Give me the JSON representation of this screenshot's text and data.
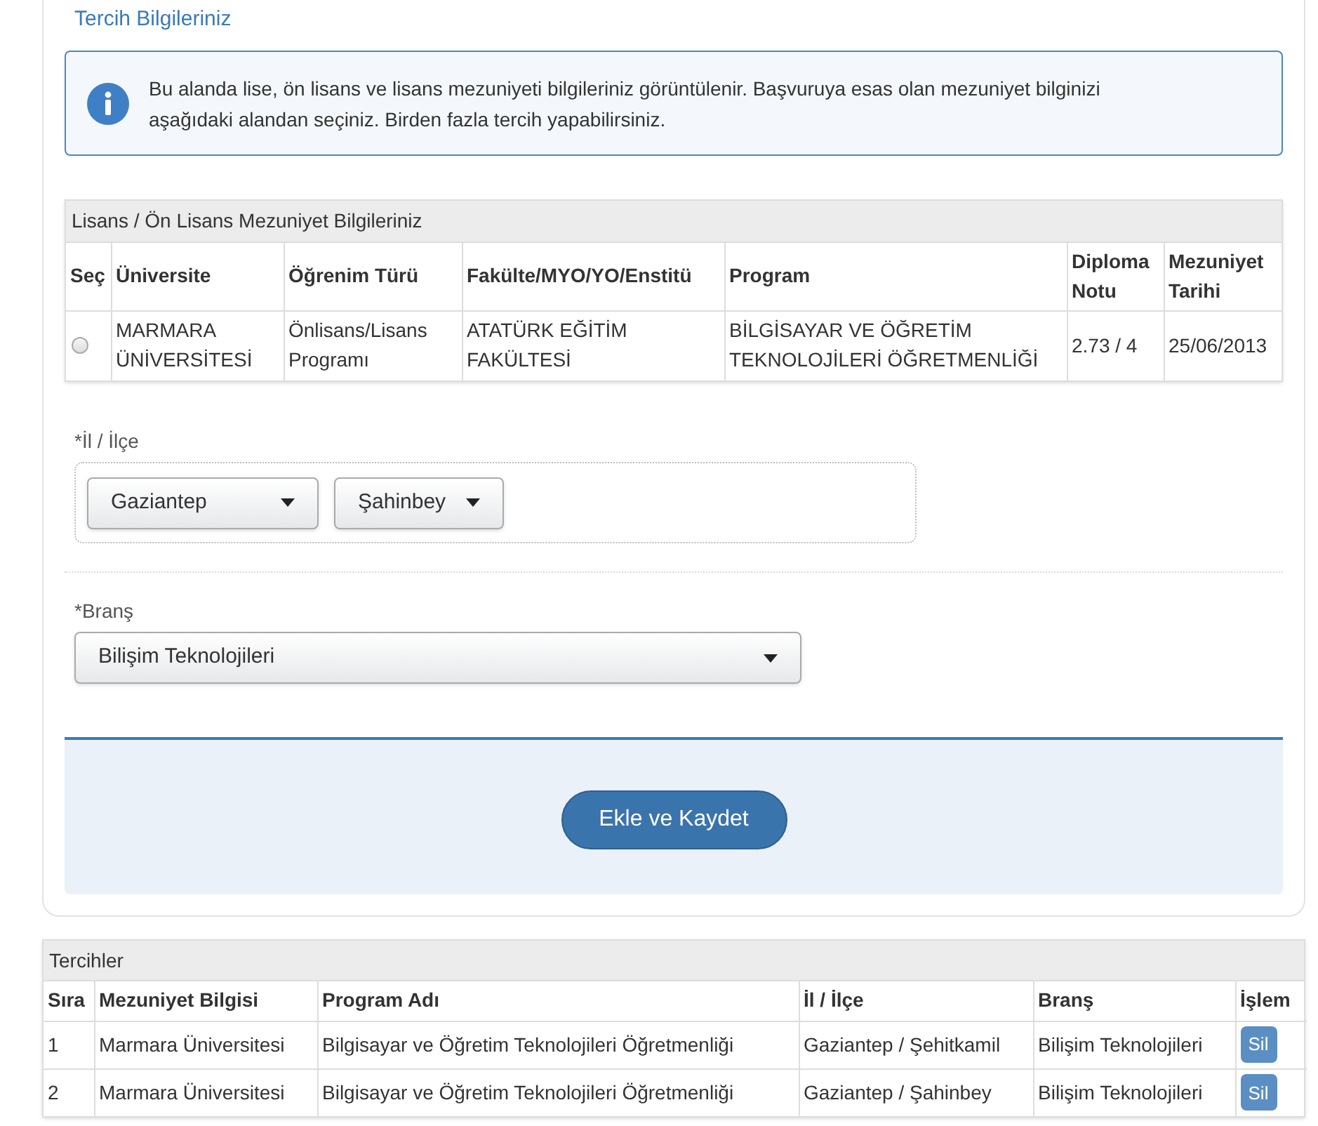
{
  "section_title": "Tercih Bilgileriniz",
  "info": {
    "text": "Bu alanda lise, ön lisans ve lisans mezuniyeti bilgileriniz görüntülenir. Başvuruya esas olan mezuniyet bilginizi aşağıdaki alandan seçiniz. Birden fazla tercih yapabilirsiniz."
  },
  "graduation_table": {
    "title": "Lisans / Ön Lisans Mezuniyet Bilgileriniz",
    "columns": [
      "Seç",
      "Üniversite",
      "Öğrenim Türü",
      "Fakülte/MYO/YO/Enstitü",
      "Program",
      "Diploma Notu",
      "Mezuniyet Tarihi"
    ],
    "rows": [
      {
        "cells": [
          {
            "kind": "radio",
            "selected": false
          },
          {
            "kind": "text",
            "text": "MARMARA ÜNİVERSİTESİ"
          },
          {
            "kind": "text",
            "text": "Önlisans/Lisans Programı"
          },
          {
            "kind": "text",
            "text": "ATATÜRK EĞİTİM FAKÜLTESİ"
          },
          {
            "kind": "text",
            "text": "BİLGİSAYAR VE ÖĞRETİM TEKNOLOJİLERİ ÖĞRETMENLİĞİ"
          },
          {
            "kind": "text",
            "text": "2.73 / 4"
          },
          {
            "kind": "text",
            "text": "25/06/2013"
          }
        ]
      }
    ]
  },
  "location": {
    "label": "*İl / İlçe",
    "province": "Gaziantep",
    "district": "Şahinbey"
  },
  "branch": {
    "label": "*Branş",
    "value": "Bilişim Teknolojileri"
  },
  "submit_button": "Ekle ve Kaydet",
  "preferences": {
    "title": "Tercihler",
    "columns": [
      "Sıra",
      "Mezuniyet Bilgisi",
      "Program Adı",
      "İl / İlçe",
      "Branş",
      "İşlem"
    ],
    "rows": [
      {
        "cells": [
          "1",
          "Marmara Üniversitesi",
          "Bilgisayar ve Öğretim Teknolojileri Öğretmenliği",
          "Gaziantep / Şehitkamil",
          "Bilişim Teknolojileri"
        ],
        "action": "Sil"
      },
      {
        "cells": [
          "2",
          "Marmara Üniversitesi",
          "Bilgisayar ve Öğretim Teknolojileri Öğretmenliği",
          "Gaziantep / Şahinbey",
          "Bilişim Teknolojileri"
        ],
        "action": "Sil"
      }
    ]
  }
}
